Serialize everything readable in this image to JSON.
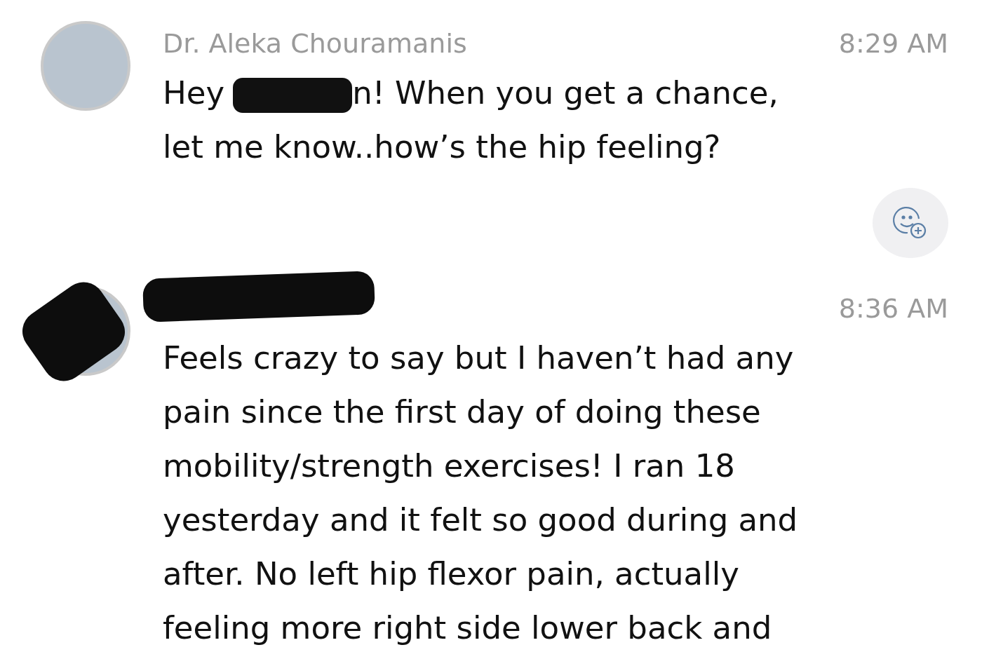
{
  "messages": [
    {
      "avatar": {
        "kind": "photo"
      },
      "sender": {
        "kind": "name",
        "text": "Dr. Aleka Chouramanis"
      },
      "time": "8:29 AM",
      "first_line": [
        {
          "kind": "text",
          "text": "Hey"
        },
        {
          "kind": "redaction"
        },
        {
          "kind": "text",
          "text": "n! When you get a chance,"
        }
      ],
      "lines": [
        "let me know..how’s the hip feeling?"
      ],
      "actions": [
        {
          "kind": "add_reaction"
        }
      ]
    },
    {
      "avatar": {
        "kind": "redacted"
      },
      "sender": {
        "kind": "redacted"
      },
      "time": "8:36 AM",
      "lines": [
        "Feels crazy to say but I haven’t had any",
        "pain since the first day of doing these",
        "mobility/strength exercises! I ran 18",
        "yesterday and it felt so good during and",
        "after. No left hip flexor pain, actually",
        "feeling more right side lower back and"
      ]
    }
  ]
}
